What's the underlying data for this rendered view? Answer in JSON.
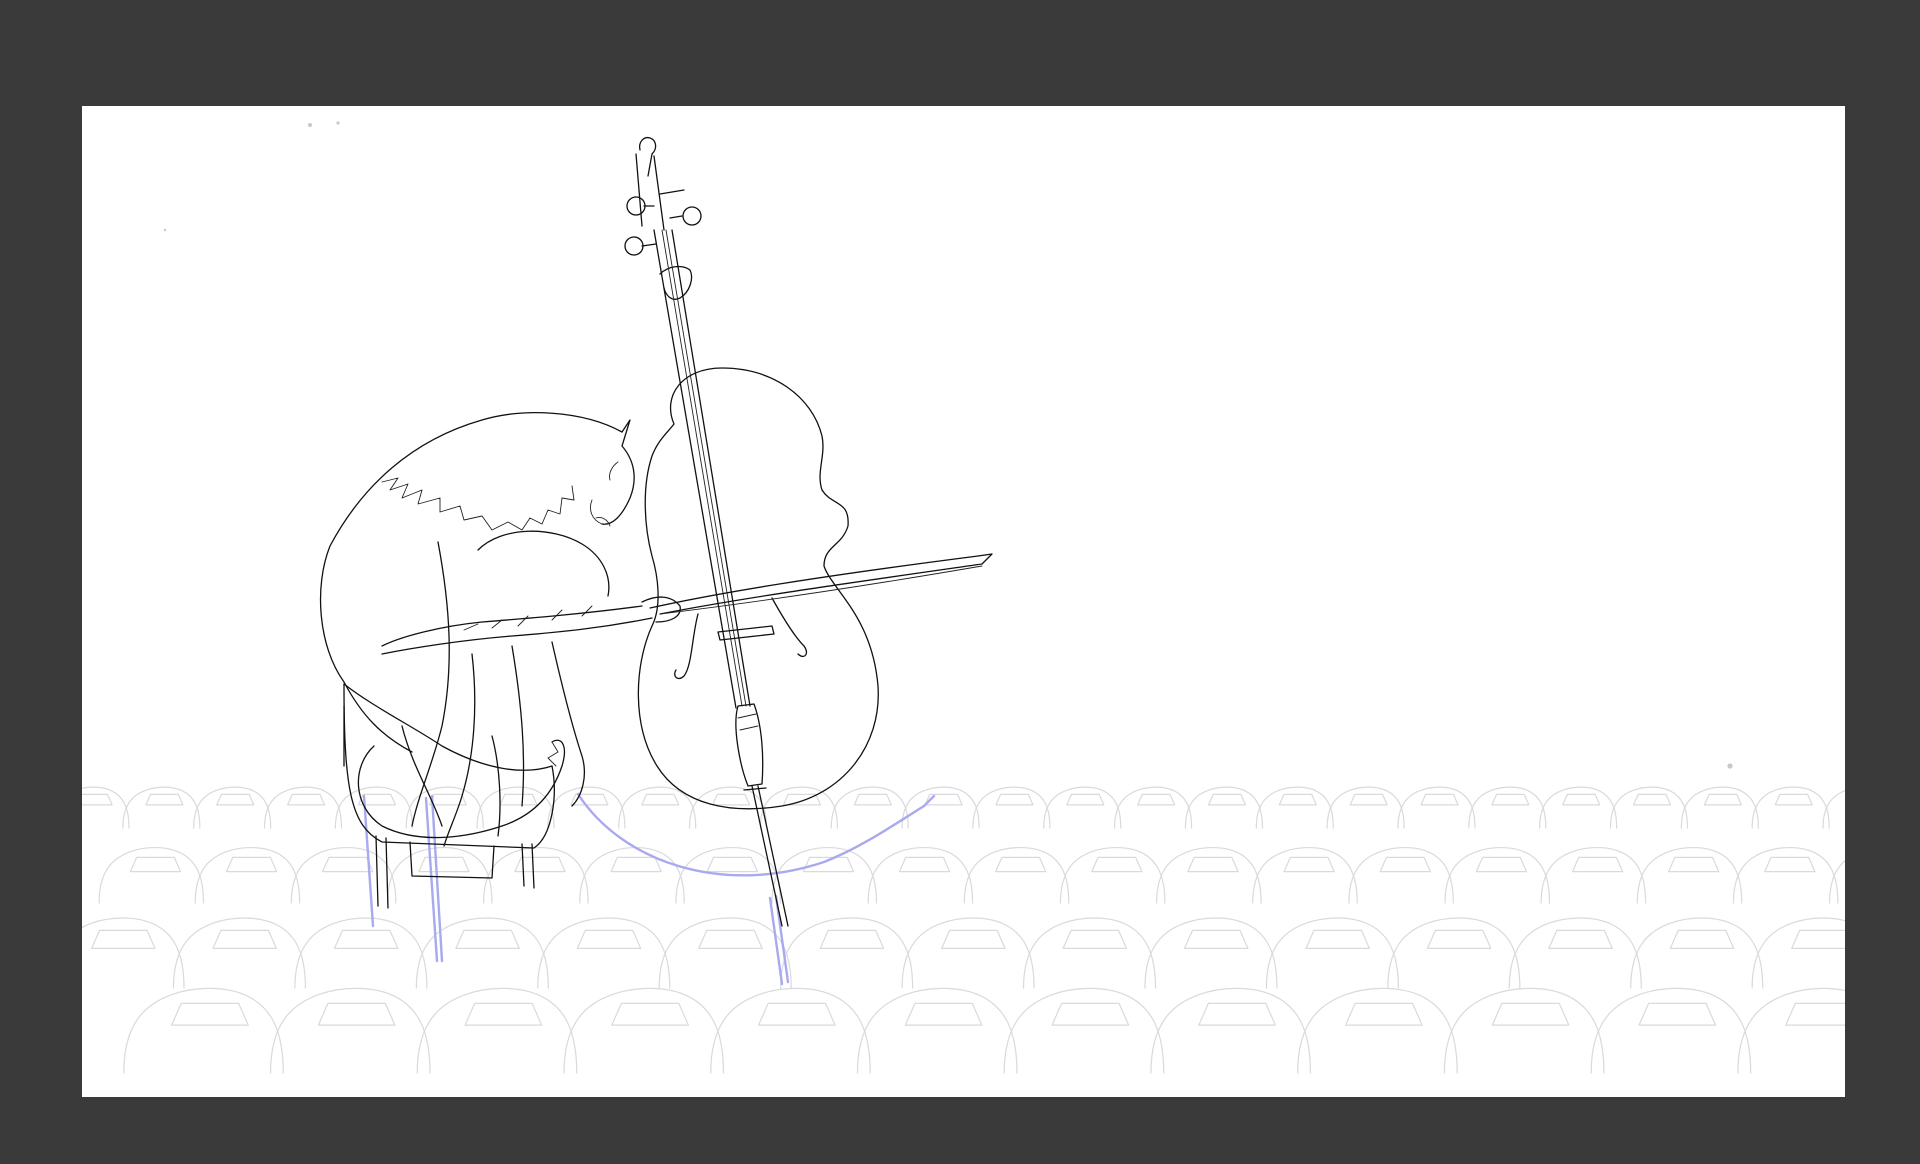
{
  "colors": {
    "workspace_background": "#3a3a3a",
    "canvas_background": "#ffffff",
    "line_art": "#111111",
    "background_sketch": "#d9d9df",
    "construction_lines": "#a9a9ef"
  },
  "drawing": {
    "subject": "line-art-cat-playing-cello",
    "background": "sketched-parked-cars",
    "car_rows": 4
  }
}
